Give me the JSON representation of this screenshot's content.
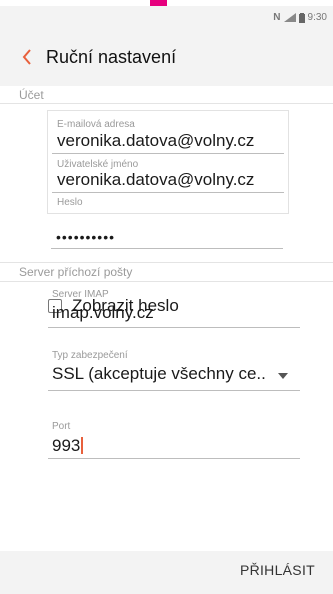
{
  "status": {
    "signal_text": "N",
    "time": "9:30"
  },
  "header": {
    "title": "Ruční nastavení"
  },
  "account_section": {
    "label": "Účet",
    "email_label": "E-mailová adresa",
    "email_value": "veronika.datova@volny.cz",
    "username_label": "Uživatelské jméno",
    "username_value": "veronika.datova@volny.cz",
    "password_label": "Heslo",
    "password_value": "••••••••••",
    "show_password_label": "Zobrazit heslo",
    "show_password_checked": false
  },
  "incoming_section": {
    "label": "Server příchozí pošty",
    "server_label": "Server IMAP",
    "server_value": "imap.volny.cz",
    "security_label": "Typ zabezpečení",
    "security_value": "SSL (akceptuje všechny ce..",
    "port_label": "Port",
    "port_value": "993"
  },
  "footer": {
    "login_label": "PŘIHLÁSIT"
  },
  "colors": {
    "accent": "#e8603c",
    "brand_tab": "#e6007e",
    "bar_bg": "#f3f3f3"
  },
  "icons": [
    "back-chevron-icon",
    "nfc-icon",
    "signal-icon",
    "battery-icon",
    "dropdown-arrow-icon"
  ]
}
